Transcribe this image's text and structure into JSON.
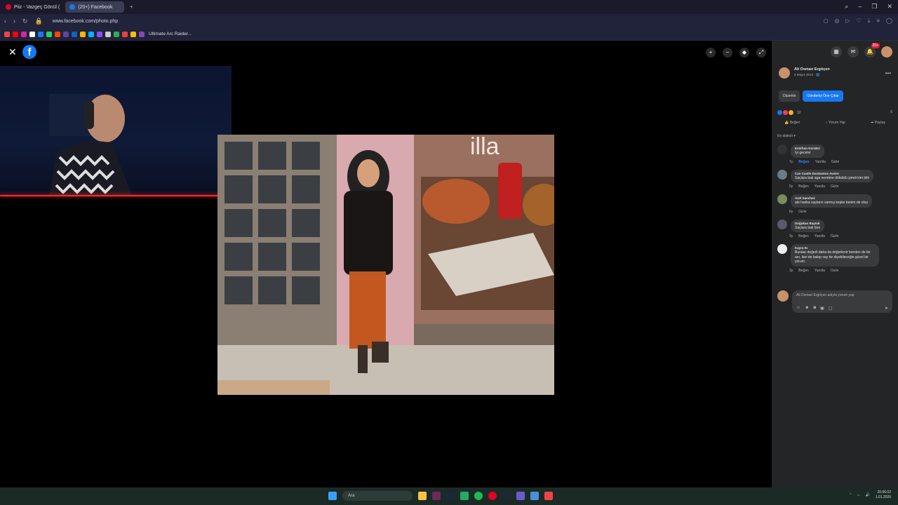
{
  "browser": {
    "tabs": [
      {
        "label": "Piiz - Vazgeç Gönül (",
        "active": false
      },
      {
        "label": "(20+) Facebook",
        "active": true
      }
    ],
    "url": "www.facebook.com/photo.php",
    "bookmark_label": "Ultimate Arc Raider..."
  },
  "viewer": {
    "close": "✕",
    "logo": "f"
  },
  "sidebar": {
    "notif_badge": "20+",
    "author_name": "Ali Osman Ergöçen",
    "author_date": "2 Mayıs 2013 · 🌐",
    "edit_label": "Düzenle",
    "promote_label": "Gönderiyi Öne Çıkar",
    "reaction_count": "32",
    "share_count": "6",
    "like_label": "Beğen",
    "comment_label": "Yorum Yap",
    "share_label": "Paylaş",
    "sort_label": "En alakalı ▾",
    "comments": [
      {
        "name": "Emirhan Korakci",
        "text": "İyi geceler",
        "meta": [
          "7y",
          "Beğen",
          "Yanıtla",
          "Gizle"
        ]
      },
      {
        "name": "Can Castle DosSantos Aveiro",
        "text": "Saçlara bak aga nerelere döküldü şimdi kim bilir",
        "meta": [
          "6y",
          "Beğen",
          "Yanıtla",
          "Gizle"
        ]
      },
      {
        "name": "Azel Sanchez",
        "text": "abi harika saçların varmış keşke benim de olsa",
        "meta": [
          "6y",
          "Gizle"
        ]
      },
      {
        "name": "Doğukan Baytok",
        "text": "Saçlara bak bee",
        "meta": [
          "3y",
          "Beğen",
          "Yanıtla",
          "Gizle"
        ]
      },
      {
        "name": "Kayra Kı",
        "text": "Buralar değerli daha da değerlenir benden de bir anı, ileri de bakıp vay be diyebileceğin güzel bir yorum.",
        "meta": [
          "3y",
          "Beğen",
          "Yanıtla",
          "Gizle"
        ]
      }
    ],
    "reply_placeholder": "Ali Osman Ergöçen adıyla yorum yap"
  },
  "taskbar": {
    "search": "Ara",
    "time": "20:06:02",
    "date": "1.01.2026"
  }
}
